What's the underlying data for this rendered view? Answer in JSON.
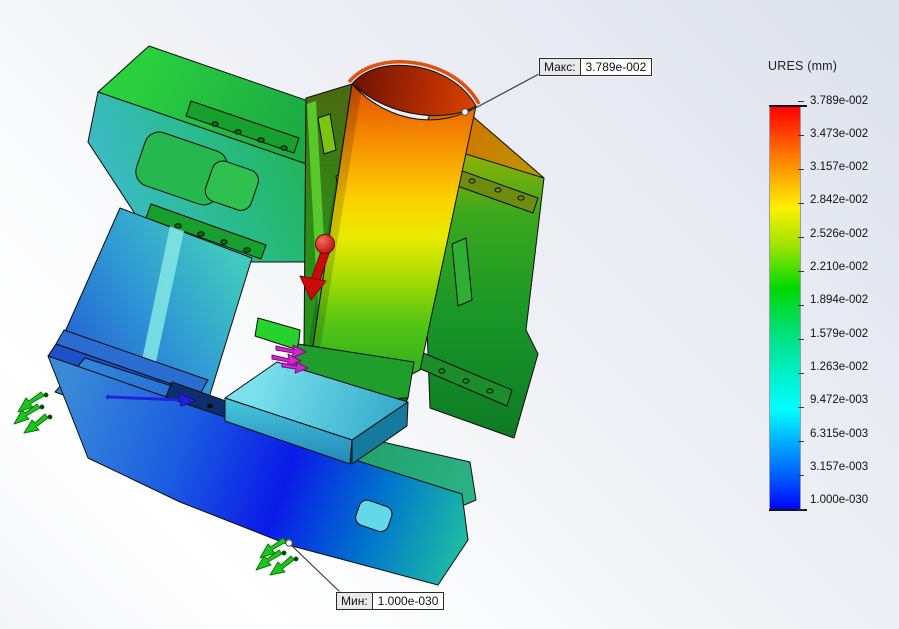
{
  "legend": {
    "title": "URES (mm)",
    "ticks": [
      "3.789e-002",
      "3.473e-002",
      "3.157e-002",
      "2.842e-002",
      "2.526e-002",
      "2.210e-002",
      "1.894e-002",
      "1.579e-002",
      "1.263e-002",
      "9.472e-003",
      "6.315e-003",
      "3.157e-003",
      "1.000e-030"
    ],
    "gradient_top_to_bottom": [
      "#ff0000",
      "#ff7800",
      "#fff000",
      "#00d800",
      "#00ffff",
      "#0000ff"
    ]
  },
  "annotations": {
    "max": {
      "label": "Макс:",
      "value": "3.789e-002"
    },
    "min": {
      "label": "Мин:",
      "value": "1.000e-030"
    }
  },
  "colors": {
    "legend_top": "#ff0000",
    "legend_bottom": "#0000ff",
    "load_arrow": "#cc0a0a",
    "fixture_symbol": "#1ec41e",
    "translation_arrow": "#cc28cc",
    "direction_arrow": "#2222dd",
    "leader_line": "#3c3c3c"
  }
}
